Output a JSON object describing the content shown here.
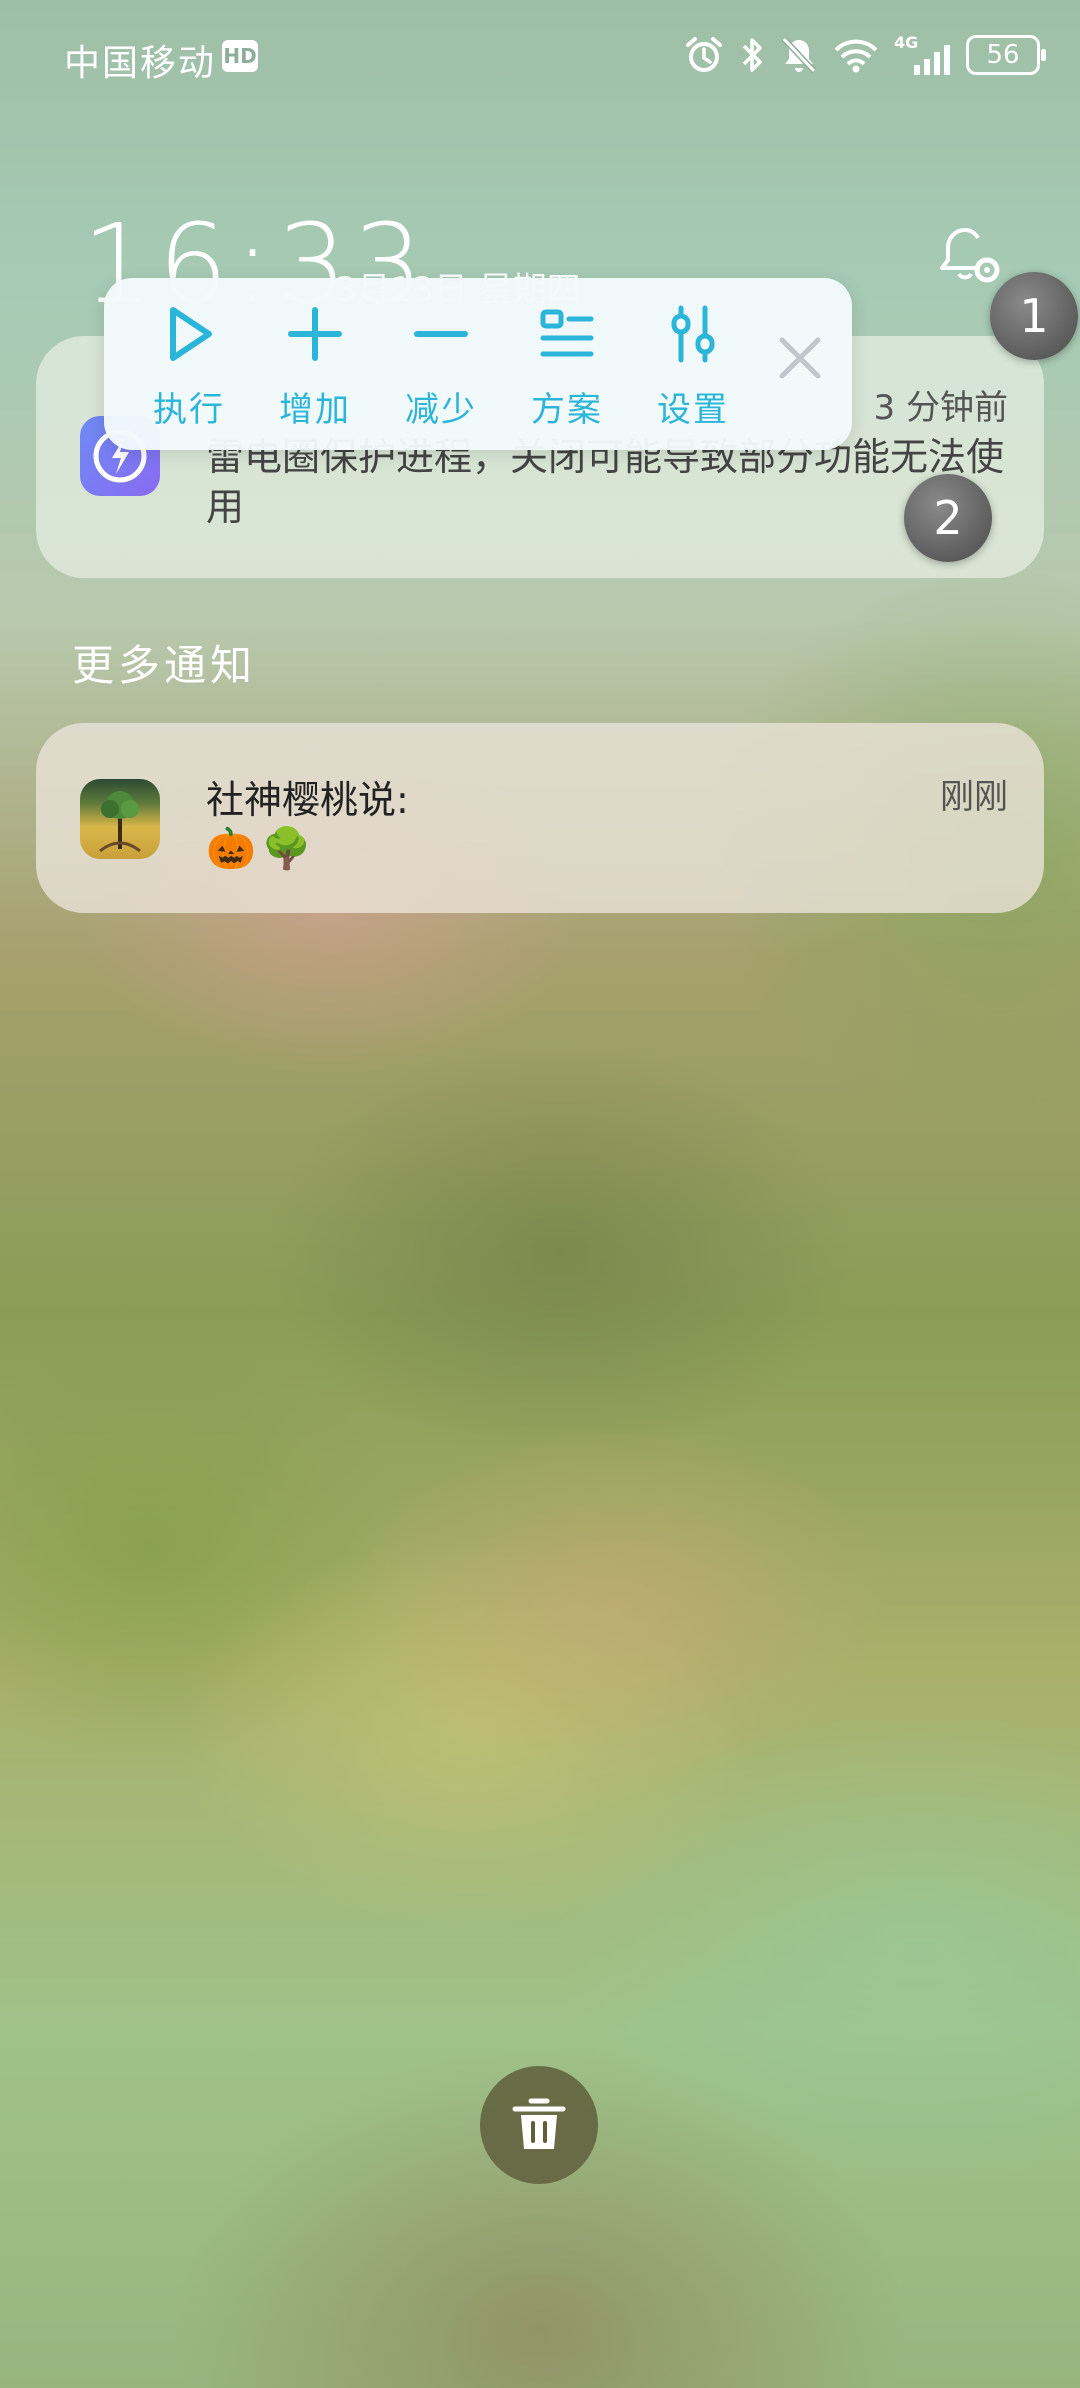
{
  "status_bar": {
    "carrier": "中国移动",
    "hd_badge": "HD",
    "network": "4G",
    "battery": "56"
  },
  "lockscreen": {
    "time": "16:33",
    "date": "3月13日 星期四"
  },
  "toolbar": {
    "items": [
      {
        "label": "执行",
        "icon": "play-icon"
      },
      {
        "label": "增加",
        "icon": "plus-icon"
      },
      {
        "label": "减少",
        "icon": "minus-icon"
      },
      {
        "label": "方案",
        "icon": "list-icon"
      },
      {
        "label": "设置",
        "icon": "sliders-icon"
      }
    ],
    "close_icon": "close-icon",
    "accent_color": "#2bb6d9"
  },
  "bubbles": [
    "1",
    "2"
  ],
  "notifications": {
    "pinned": {
      "time": "3 分钟前",
      "body": "雷电圈保护进程，关闭可能导致部分功能无法使用"
    },
    "section_title": "更多通知",
    "items": [
      {
        "title": "社神樱桃说:",
        "time": "刚刚",
        "emoji": [
          "🎃",
          "🌳"
        ]
      }
    ]
  },
  "actions": {
    "clear_icon": "trash-icon"
  }
}
